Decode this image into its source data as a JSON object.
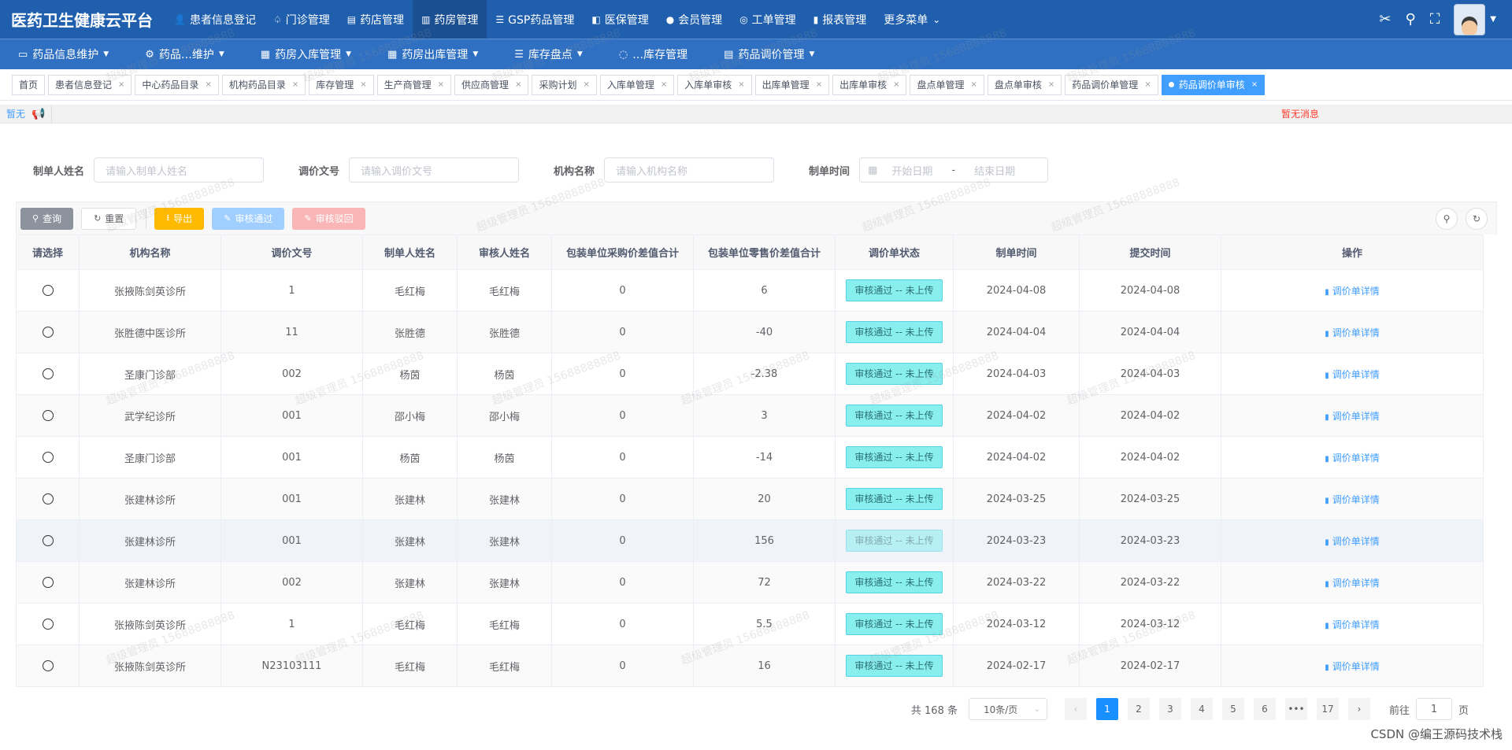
{
  "app": {
    "title": "医药卫生健康云平台",
    "nav": [
      {
        "icon": "user-icon",
        "glyph": "👤",
        "label": "患者信息登记"
      },
      {
        "icon": "clinic-icon",
        "glyph": "♤",
        "label": "门诊管理"
      },
      {
        "icon": "shop-icon",
        "glyph": "▤",
        "label": "药店管理"
      },
      {
        "icon": "pharmacy-icon",
        "glyph": "▥",
        "label": "药房管理"
      },
      {
        "icon": "list-icon",
        "glyph": "☰",
        "label": "GSP药品管理"
      },
      {
        "icon": "insurance-icon",
        "glyph": "◧",
        "label": "医保管理"
      },
      {
        "icon": "github-icon",
        "glyph": "●",
        "label": "会员管理"
      },
      {
        "icon": "ticket-icon",
        "glyph": "◎",
        "label": "工单管理"
      },
      {
        "icon": "chart-icon",
        "glyph": "▮",
        "label": "报表管理"
      }
    ],
    "more_label": "更多菜单"
  },
  "subnav": [
    {
      "icon": "drug-icon",
      "glyph": "▭",
      "label": "药品信息维护"
    },
    {
      "icon": "settings-icon",
      "glyph": "⚙",
      "label": "药品…维护"
    },
    {
      "icon": "inbound-icon",
      "glyph": "▦",
      "label": "药房入库管理"
    },
    {
      "icon": "outbound-icon",
      "glyph": "▦",
      "label": "药房出库管理"
    },
    {
      "icon": "inventory-icon",
      "glyph": "☰",
      "label": "库存盘点"
    },
    {
      "icon": "stock-icon",
      "glyph": "◌",
      "label": "…库存管理"
    },
    {
      "icon": "price-icon",
      "glyph": "▤",
      "label": "药品调价管理"
    }
  ],
  "tags": [
    "首页",
    "患者信息登记",
    "中心药品目录",
    "机构药品目录",
    "库存管理",
    "生产商管理",
    "供应商管理",
    "采购计划",
    "入库单管理",
    "入库单审核",
    "出库单管理",
    "出库单审核",
    "盘点单管理",
    "盘点单审核",
    "药品调价单管理",
    "药品调价单审核"
  ],
  "notice": {
    "left": "暂无",
    "message": "暂无消息"
  },
  "form": {
    "maker_label": "制单人姓名",
    "maker_placeholder": "请输入制单人姓名",
    "doc_label": "调价文号",
    "doc_placeholder": "请输入调价文号",
    "org_label": "机构名称",
    "org_placeholder": "请输入机构名称",
    "time_label": "制单时间",
    "start_placeholder": "开始日期",
    "date_sep": "-",
    "end_placeholder": "结束日期"
  },
  "toolbar": {
    "query": "查询",
    "reset": "重置",
    "export": "导出",
    "approve": "审核通过",
    "reject": "审核驳回"
  },
  "table": {
    "headers": [
      "请选择",
      "机构名称",
      "调价文号",
      "制单人姓名",
      "审核人姓名",
      "包装单位采购价差值合计",
      "包装单位零售价差值合计",
      "调价单状态",
      "制单时间",
      "提交时间",
      "操作"
    ],
    "rows": [
      {
        "org": "张掖陈剑英诊所",
        "doc": "1",
        "maker": "毛红梅",
        "auditor": "毛红梅",
        "purchase_diff": "0",
        "retail_diff": "6",
        "status": "审核通过 -- 未上传",
        "created": "2024-04-08",
        "submitted": "2024-04-08",
        "action": "调价单详情"
      },
      {
        "org": "张胜德中医诊所",
        "doc": "11",
        "maker": "张胜德",
        "auditor": "张胜德",
        "purchase_diff": "0",
        "retail_diff": "-40",
        "status": "审核通过 -- 未上传",
        "created": "2024-04-04",
        "submitted": "2024-04-04",
        "action": "调价单详情"
      },
      {
        "org": "圣康门诊部",
        "doc": "002",
        "maker": "杨茵",
        "auditor": "杨茵",
        "purchase_diff": "0",
        "retail_diff": "-2.38",
        "status": "审核通过 -- 未上传",
        "created": "2024-04-03",
        "submitted": "2024-04-03",
        "action": "调价单详情"
      },
      {
        "org": "武学纪诊所",
        "doc": "001",
        "maker": "邵小梅",
        "auditor": "邵小梅",
        "purchase_diff": "0",
        "retail_diff": "3",
        "status": "审核通过 -- 未上传",
        "created": "2024-04-02",
        "submitted": "2024-04-02",
        "action": "调价单详情"
      },
      {
        "org": "圣康门诊部",
        "doc": "001",
        "maker": "杨茵",
        "auditor": "杨茵",
        "purchase_diff": "0",
        "retail_diff": "-14",
        "status": "审核通过 -- 未上传",
        "created": "2024-04-02",
        "submitted": "2024-04-02",
        "action": "调价单详情"
      },
      {
        "org": "张建林诊所",
        "doc": "001",
        "maker": "张建林",
        "auditor": "张建林",
        "purchase_diff": "0",
        "retail_diff": "20",
        "status": "审核通过 -- 未上传",
        "created": "2024-03-25",
        "submitted": "2024-03-25",
        "action": "调价单详情"
      },
      {
        "org": "张建林诊所",
        "doc": "001",
        "maker": "张建林",
        "auditor": "张建林",
        "purchase_diff": "0",
        "retail_diff": "156",
        "status": "审核通过 -- 未上传",
        "created": "2024-03-23",
        "submitted": "2024-03-23",
        "action": "调价单详情"
      },
      {
        "org": "张建林诊所",
        "doc": "002",
        "maker": "张建林",
        "auditor": "张建林",
        "purchase_diff": "0",
        "retail_diff": "72",
        "status": "审核通过 -- 未上传",
        "created": "2024-03-22",
        "submitted": "2024-03-22",
        "action": "调价单详情"
      },
      {
        "org": "张掖陈剑英诊所",
        "doc": "1",
        "maker": "毛红梅",
        "auditor": "毛红梅",
        "purchase_diff": "0",
        "retail_diff": "5.5",
        "status": "审核通过 -- 未上传",
        "created": "2024-03-12",
        "submitted": "2024-03-12",
        "action": "调价单详情"
      },
      {
        "org": "张掖陈剑英诊所",
        "doc": "N23103111",
        "maker": "毛红梅",
        "auditor": "毛红梅",
        "purchase_diff": "0",
        "retail_diff": "16",
        "status": "审核通过 -- 未上传",
        "created": "2024-02-17",
        "submitted": "2024-02-17",
        "action": "调价单详情"
      }
    ]
  },
  "pagination": {
    "total": "共 168 条",
    "page_size": "10条/页",
    "pages": [
      "1",
      "2",
      "3",
      "4",
      "5",
      "6",
      "•••",
      "17"
    ],
    "current": "1",
    "goto_prefix": "前往",
    "goto_value": "1",
    "goto_suffix": "页"
  },
  "watermark": "超级管理员 15688888888",
  "footer": "CSDN @编王源码技术栈"
}
